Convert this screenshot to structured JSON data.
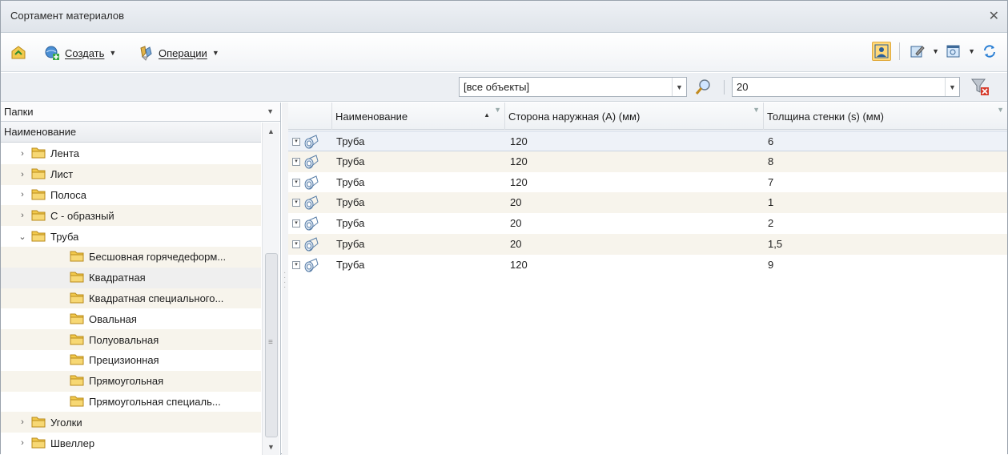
{
  "window": {
    "title": "Сортамент материалов"
  },
  "toolbar": {
    "create_label": "Создать",
    "operations_label": "Операции",
    "icons": [
      "back-icon",
      "create-icon",
      "operations-icon",
      "user-filter-icon",
      "edit-icon",
      "view-icon",
      "refresh-icon"
    ]
  },
  "search": {
    "scope_value": "[все объекты]",
    "query_value": "20"
  },
  "folders": {
    "header": "Папки",
    "column": "Наименование",
    "items": [
      {
        "label": "Лента",
        "level": 0,
        "expander": ">"
      },
      {
        "label": "Лист",
        "level": 0,
        "expander": ">"
      },
      {
        "label": "Полоса",
        "level": 0,
        "expander": ">"
      },
      {
        "label": "С - образный",
        "level": 0,
        "expander": ">"
      },
      {
        "label": "Труба",
        "level": 0,
        "expander": "v"
      },
      {
        "label": "Бесшовная горячедеформ...",
        "level": 1,
        "expander": ""
      },
      {
        "label": "Квадратная",
        "level": 1,
        "expander": ""
      },
      {
        "label": "Квадратная специального...",
        "level": 1,
        "expander": ""
      },
      {
        "label": "Овальная",
        "level": 1,
        "expander": ""
      },
      {
        "label": "Полуовальная",
        "level": 1,
        "expander": ""
      },
      {
        "label": "Прецизионная",
        "level": 1,
        "expander": ""
      },
      {
        "label": "Прямоугольная",
        "level": 1,
        "expander": ""
      },
      {
        "label": "Прямоугольная специаль...",
        "level": 1,
        "expander": ""
      },
      {
        "label": "Уголки",
        "level": 0,
        "expander": ">"
      },
      {
        "label": "Швеллер",
        "level": 0,
        "expander": ">"
      }
    ]
  },
  "grid": {
    "columns": [
      "Наименование",
      "Сторона наружная (А) (мм)",
      "Толщина стенки (s) (мм)"
    ],
    "rows": [
      {
        "name": "Труба",
        "side": "120",
        "wall": "6"
      },
      {
        "name": "Труба",
        "side": "120",
        "wall": "8"
      },
      {
        "name": "Труба",
        "side": "120",
        "wall": "7"
      },
      {
        "name": "Труба",
        "side": "20",
        "wall": "1"
      },
      {
        "name": "Труба",
        "side": "20",
        "wall": "2"
      },
      {
        "name": "Труба",
        "side": "20",
        "wall": "1,5"
      },
      {
        "name": "Труба",
        "side": "120",
        "wall": "9"
      }
    ]
  },
  "colors": {
    "selected_row": "#eef2f8",
    "alt_row": "#f7f4ec",
    "folder_yellow": "#f2c94c",
    "active_tool": "#ffd97a"
  }
}
